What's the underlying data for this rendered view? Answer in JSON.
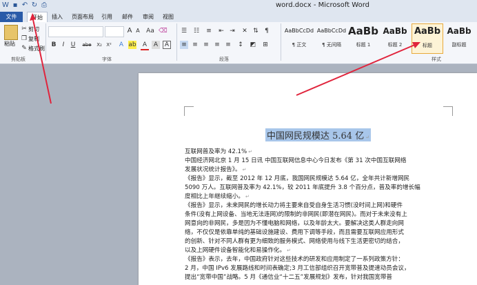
{
  "titlebar": {
    "title": "word.docx - Microsoft Word"
  },
  "tabs": [
    "文件",
    "开始",
    "插入",
    "页面布局",
    "引用",
    "邮件",
    "审阅",
    "视图"
  ],
  "clipboard": {
    "paste": "粘贴",
    "cut": "剪切",
    "copy": "复制",
    "format_painter": "格式刷",
    "group": "剪贴板"
  },
  "font": {
    "group": "字体",
    "size_btn_a_up": "A",
    "size_btn_a_down": "A",
    "aa": "Aa",
    "bold": "B",
    "italic": "I",
    "underline": "U",
    "abc": "abe",
    "sub": "X₂",
    "sup": "X²"
  },
  "paragraph": {
    "group": "段落"
  },
  "styles": {
    "group": "样式",
    "items": [
      {
        "preview": "AaBbCcDd",
        "name": "¶ 正文"
      },
      {
        "preview": "AaBbCcDd",
        "name": "¶ 无间隔"
      },
      {
        "preview": "AaBb",
        "name": "标题 1"
      },
      {
        "preview": "AaBb",
        "name": "标题 2"
      },
      {
        "preview": "AaBb",
        "name": "标题"
      },
      {
        "preview": "AaBb",
        "name": "副标题"
      }
    ]
  },
  "doc": {
    "title": "中国网民规模达 5.64 亿",
    "lines": [
      "互联网普及率为 42.1%",
      "中国经济网北京 1 月 15 日讯  中国互联网信息中心今日发布《第 31 次中国互联网络",
      "发展状况统计报告》。",
      "《报告》显示，截至 2012 年 12 月底，我国网民规模达 5.64 亿，全年共计新增网民",
      "5090 万人。互联网普及率为 42.1%，较 2011 年底提升 3.8 个百分点，普及率的增长幅",
      "度相比上年继续缩小。",
      "《报告》显示，未来网民的增长动力将主要来自受自身生活习惯(没时间上网)和硬件",
      "条件(没有上网设备、当地无法连网)的限制的非网民(即潜在网民)。而对于未来没有上",
      "网意向的非网民，多是因为不懂电脑和网络，以及年龄太大。要解决这类人群走向网",
      "络，不仅仅是依靠单纯的基础设施建设、费用下调等手段，而且需要互联网应用形式",
      "的创新、针对不同人群有更为细致的服务模式、网络使用与线下生活更密切的结合，",
      "以及上网硬件设备智能化和易操作化。",
      "《报告》表示，去年，中国政府针对这些技术的研发和应用制定了一系列政策方针：",
      "2 月，中国 IPv6 发展路线和时间表确定;3 月工信部组织召开宽带普及提速动员会议，",
      "提出“宽带中国”战略。5 月《通信业“十二五”发展规划》发布，针对我国宽带普"
    ]
  },
  "colors": {
    "file_tab": "#2a5ba8",
    "arrow": "#e0243c",
    "selection": "#a8c6ea"
  }
}
